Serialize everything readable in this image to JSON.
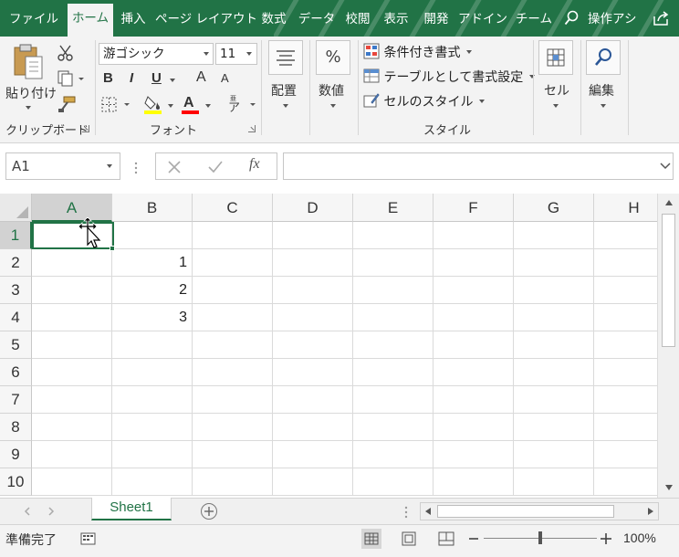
{
  "tabs": [
    "ファイル",
    "ホーム",
    "挿入",
    "ページ レイアウト",
    "数式",
    "データ",
    "校閲",
    "表示",
    "開発",
    "アドイン",
    "チーム",
    "操作アシ"
  ],
  "active_tab": "ホーム",
  "clipboard": {
    "paste_label": "貼り付け",
    "group_label": "クリップボード"
  },
  "font": {
    "name": "游ゴシック",
    "size": "11",
    "group_label": "フォント",
    "bold": "B",
    "italic": "I",
    "underline": "U",
    "grow": "A",
    "shrink": "A",
    "fill_color": "#ffff00",
    "font_color": "#ff0000"
  },
  "alignment": {
    "label": "配置"
  },
  "number": {
    "label": "数値",
    "percent": "%"
  },
  "styles": {
    "conditional": "条件付き書式",
    "table": "テーブルとして書式設定",
    "cell_styles": "セルのスタイル",
    "group_label": "スタイル"
  },
  "cells": {
    "label": "セル"
  },
  "editing": {
    "label": "編集"
  },
  "formula_bar": {
    "name_box": "A1",
    "fx": "fx",
    "formula": ""
  },
  "grid": {
    "columns": [
      "A",
      "B",
      "C",
      "D",
      "E",
      "F",
      "G",
      "H"
    ],
    "rows": [
      "1",
      "2",
      "3",
      "4",
      "5",
      "6",
      "7",
      "8",
      "9",
      "10"
    ],
    "values": [
      [
        "",
        "",
        "",
        "",
        "",
        "",
        "",
        ""
      ],
      [
        "",
        "1",
        "",
        "",
        "",
        "",
        "",
        ""
      ],
      [
        "",
        "2",
        "",
        "",
        "",
        "",
        "",
        ""
      ],
      [
        "",
        "3",
        "",
        "",
        "",
        "",
        "",
        ""
      ],
      [
        "",
        "",
        "",
        "",
        "",
        "",
        "",
        ""
      ],
      [
        "",
        "",
        "",
        "",
        "",
        "",
        "",
        ""
      ],
      [
        "",
        "",
        "",
        "",
        "",
        "",
        "",
        ""
      ],
      [
        "",
        "",
        "",
        "",
        "",
        "",
        "",
        ""
      ],
      [
        "",
        "",
        "",
        "",
        "",
        "",
        "",
        ""
      ],
      [
        "",
        "",
        "",
        "",
        "",
        "",
        "",
        ""
      ]
    ],
    "selected_cell": "A1"
  },
  "sheets": [
    "Sheet1"
  ],
  "status": {
    "text": "準備完了",
    "zoom": "100%"
  },
  "colors": {
    "accent": "#217346",
    "ribbon_bg": "#f3f3f3"
  }
}
